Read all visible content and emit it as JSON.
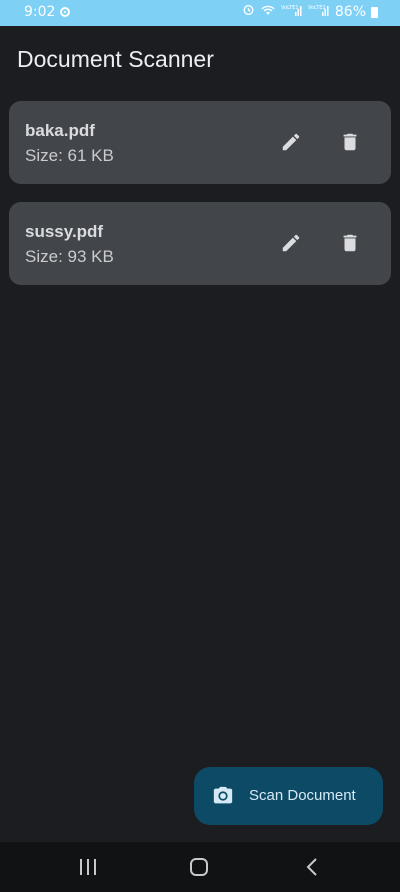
{
  "status_bar": {
    "time": "9:02",
    "network_label_1": "VoLTE1",
    "network_label_2": "VoLTE2",
    "battery": "86%"
  },
  "app": {
    "title": "Document Scanner"
  },
  "documents": [
    {
      "name": "baka.pdf",
      "size": "Size: 61 KB"
    },
    {
      "name": "sussy.pdf",
      "size": "Size: 93 KB"
    }
  ],
  "fab": {
    "label": "Scan Document",
    "icon": "camera-icon"
  },
  "icons": {
    "edit": "pencil-icon",
    "delete": "trash-icon"
  },
  "colors": {
    "status_bar": "#7fd0f5",
    "background": "#1b1d20",
    "card": "#42454a",
    "fab": "#0c4a65"
  }
}
